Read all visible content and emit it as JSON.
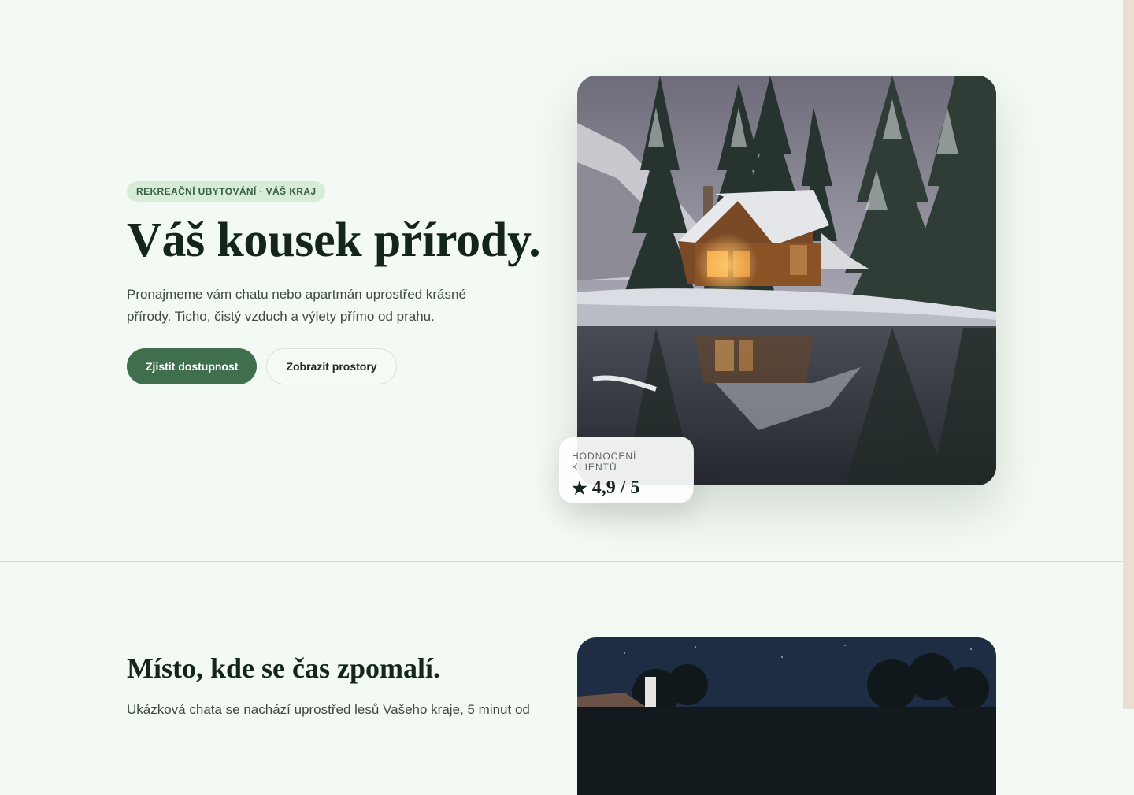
{
  "hero": {
    "eyebrow": "REKREAČNÍ UBYTOVÁNÍ · VÁŠ KRAJ",
    "title": "Váš kousek přírody.",
    "lead": "Pronajmeme vám chatu nebo apartmán uprostřed krásné přírody. Ticho, čistý vzduch a výlety přímo od prahu.",
    "primary_button": "Zjistit dostupnost",
    "secondary_button": "Zobrazit prostory"
  },
  "rating": {
    "label": "HODNOCENÍ KLIENTŮ",
    "star_icon": "★",
    "value": "4,9 / 5"
  },
  "about": {
    "title": "Místo, kde se čas zpomalí.",
    "text": "Ukázková chata se nachází uprostřed lesů Vašeho kraje, 5 minut od"
  },
  "colors": {
    "background": "#f3f9f3",
    "accent": "#3f6f4d",
    "eyebrow_bg": "#d6ecd9",
    "heading": "#14261b",
    "scroll_strip": "#eadfd1"
  }
}
